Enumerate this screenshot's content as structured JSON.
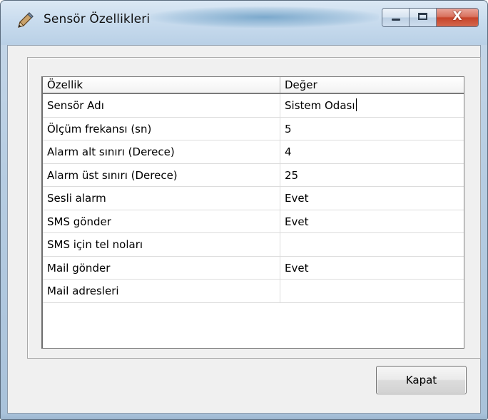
{
  "window": {
    "title": "Sensör Özellikleri",
    "app_icon": "pen-icon",
    "controls": {
      "minimize_icon": "minimize-icon",
      "maximize_icon": "maximize-icon",
      "close_icon": "close-icon",
      "close_glyph": "X"
    }
  },
  "grid": {
    "columns": [
      "Özellik",
      "Değer"
    ],
    "rows": [
      {
        "property": "Sensör Adı",
        "value": "Sistem Odası"
      },
      {
        "property": "Ölçüm frekansı (sn)",
        "value": "5"
      },
      {
        "property": "Alarm alt sınırı (Derece)",
        "value": "4"
      },
      {
        "property": "Alarm üst sınırı (Derece)",
        "value": "25"
      },
      {
        "property": "Sesli alarm",
        "value": "Evet"
      },
      {
        "property": "SMS gönder",
        "value": "Evet"
      },
      {
        "property": "SMS için tel noları",
        "value": ""
      },
      {
        "property": "Mail gönder",
        "value": "Evet"
      },
      {
        "property": "Mail adresleri",
        "value": ""
      }
    ]
  },
  "buttons": {
    "close_label": "Kapat"
  },
  "colors": {
    "title_glow": "#3a7eb0",
    "close_button": "#c6442a",
    "window_frame": "#b9d0e6"
  }
}
